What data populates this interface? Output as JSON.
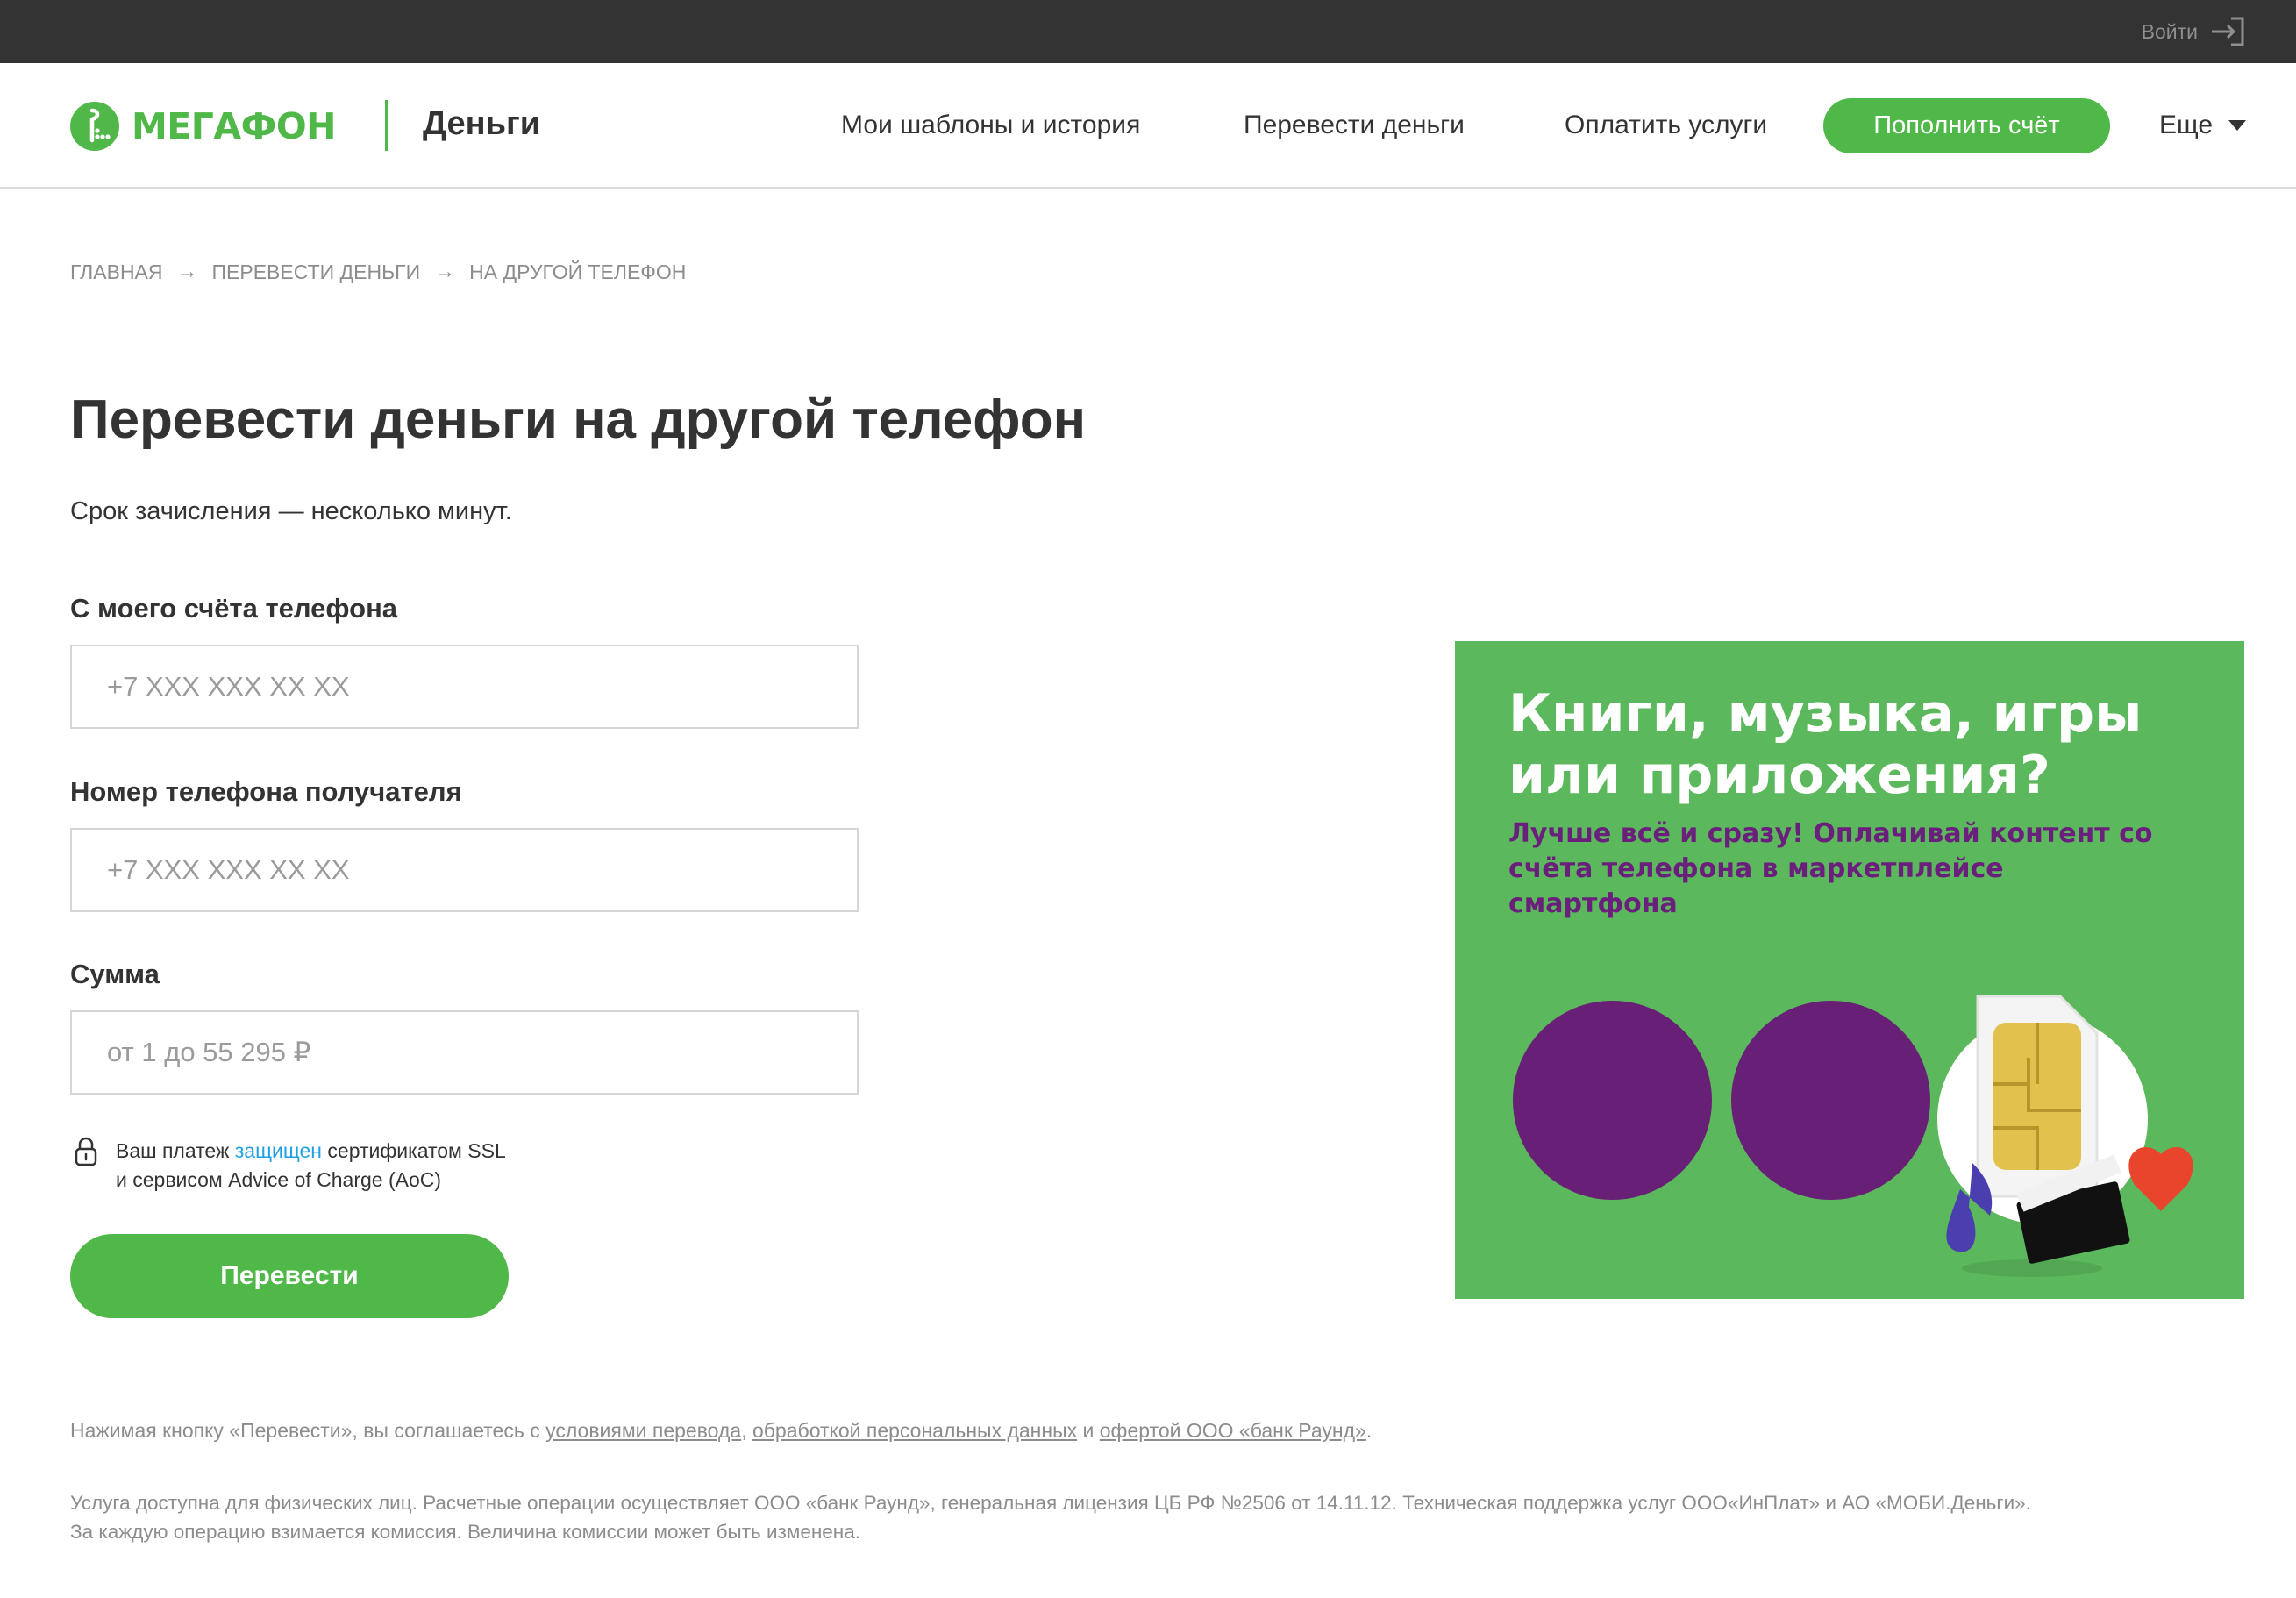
{
  "topbar": {
    "login_label": "Войти"
  },
  "header": {
    "logo_text": "МегаФон",
    "product": "Деньги",
    "nav": [
      "Мои шаблоны и история",
      "Перевести деньги",
      "Оплатить услуги"
    ],
    "topup_label": "Пополнить счёт",
    "more_label": "Еще"
  },
  "breadcrumb": [
    "ГЛАВНАЯ",
    "ПЕРЕВЕСТИ ДЕНЬГИ",
    "НА ДРУГОЙ ТЕЛЕФОН"
  ],
  "page": {
    "title": "Перевести деньги на другой телефон",
    "subtitle": "Срок зачисления — несколько минут."
  },
  "form": {
    "from_label": "С моего счёта телефона",
    "from_placeholder": "+7 XXX XXX XX XX",
    "from_value": "",
    "to_label": "Номер телефона получателя",
    "to_placeholder": "+7 XXX XXX XX XX",
    "to_value": "",
    "amount_label": "Сумма",
    "amount_placeholder": "от 1 до 55 295 ₽",
    "amount_value": "",
    "secure_prefix": "Ваш платеж ",
    "secure_link": "защищен",
    "secure_suffix": " сертификатом SSL",
    "secure_line2": "и сервисом Advice of Charge (AoC)",
    "submit_label": "Перевести"
  },
  "banner": {
    "title": "Книги, музыка, игры или приложения?",
    "subtitle": "Лучше всё и сразу! Оплачивай контент со счёта телефона в маркетплейсе смартфона"
  },
  "legal": {
    "prefix": "Нажимая кнопку «Перевести», вы соглашаетесь с ",
    "link1": "условиями перевода",
    "sep1": ", ",
    "link2": "обработкой персональных данных",
    "sep2": " и ",
    "link3": "офертой ООО «банк Раунд»",
    "suffix": "."
  },
  "footnote": {
    "line1": "Услуга доступна для физических лиц. Расчетные операции осуществляет ООО «банк Раунд», генеральная лицензия ЦБ РФ №2506 от 14.11.12. Техническая поддержка услуг ООО«ИнПлат» и АО «МОБИ.Деньги».",
    "line2": "За каждую операцию взимается комиссия. Величина комиссии может быть изменена."
  },
  "colors": {
    "brand_green": "#50b848",
    "brand_purple": "#682077",
    "topbar": "#333333",
    "link_blue": "#1fa0e3"
  },
  "icons": [
    "login-icon",
    "chevron-down-icon",
    "lock-icon",
    "megafon-logo-icon"
  ]
}
